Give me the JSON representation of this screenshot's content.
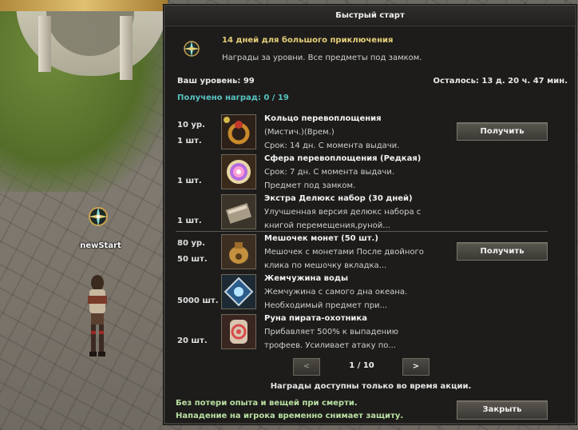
{
  "scene": {
    "player_name": "newStart"
  },
  "panel": {
    "title": "Быстрый старт",
    "intro": {
      "title": "14 дней для большого приключения",
      "description": "Награды за уровни. Все предметы под замком."
    },
    "level_label": "Ваш уровень: 99",
    "remaining_label": "Осталось: 13 д. 20 ч. 47 мин.",
    "received_label": "Получено наград: 0 / 19",
    "groups": [
      {
        "requirement": "10 ур.",
        "claim_label": "Получить",
        "items": [
          {
            "count": "1 шт.",
            "name": "Кольцо перевоплощения",
            "desc_lines": [
              "(Мистич.)(Врем.)",
              "Срок: 14 дн. С момента выдачи."
            ],
            "icon": "ring-icon"
          },
          {
            "count": "1 шт.",
            "name": "Сфера перевоплощения (Редкая)",
            "desc_lines": [
              "Срок: 7 дн. С момента выдачи.",
              "Предмет под замком."
            ],
            "icon": "sphere-icon"
          },
          {
            "count": "1 шт.",
            "name": "Экстра Делюкс набор (30 дней)",
            "desc_lines": [
              "Улучшенная версия делюкс набора с",
              "книгой перемещения,руной..."
            ],
            "icon": "chest-icon"
          }
        ]
      },
      {
        "requirement": "80 ур.",
        "claim_label": "Получить",
        "items": [
          {
            "count": "50 шт.",
            "name": "Мешочек монет (50 шт.)",
            "desc_lines": [
              "Мешочек с монетами После двойного",
              "клика по мешочку вкладка..."
            ],
            "icon": "coin-pouch-icon"
          },
          {
            "count": "5000 шт.",
            "name": "Жемчужина воды",
            "desc_lines": [
              "Жемчужина с самого дна океана.",
              "Необходимый предмет при..."
            ],
            "icon": "water-pearl-icon"
          },
          {
            "count": "20 шт.",
            "name": "Руна пирата-охотника",
            "desc_lines": [
              "Прибавляет 500% к выпадению",
              "трофеев. Усиливает атаку по..."
            ],
            "icon": "pirate-rune-icon"
          }
        ]
      }
    ],
    "pager": {
      "prev": "<",
      "next": ">",
      "label": "1 / 10"
    },
    "promo_note": "Награды доступны только во время акции.",
    "footer": {
      "line1": "Без потери опыта и вещей при смерти.",
      "line2": "Нападение на игрока временно снимает защиту.",
      "close_label": "Закрыть"
    }
  }
}
